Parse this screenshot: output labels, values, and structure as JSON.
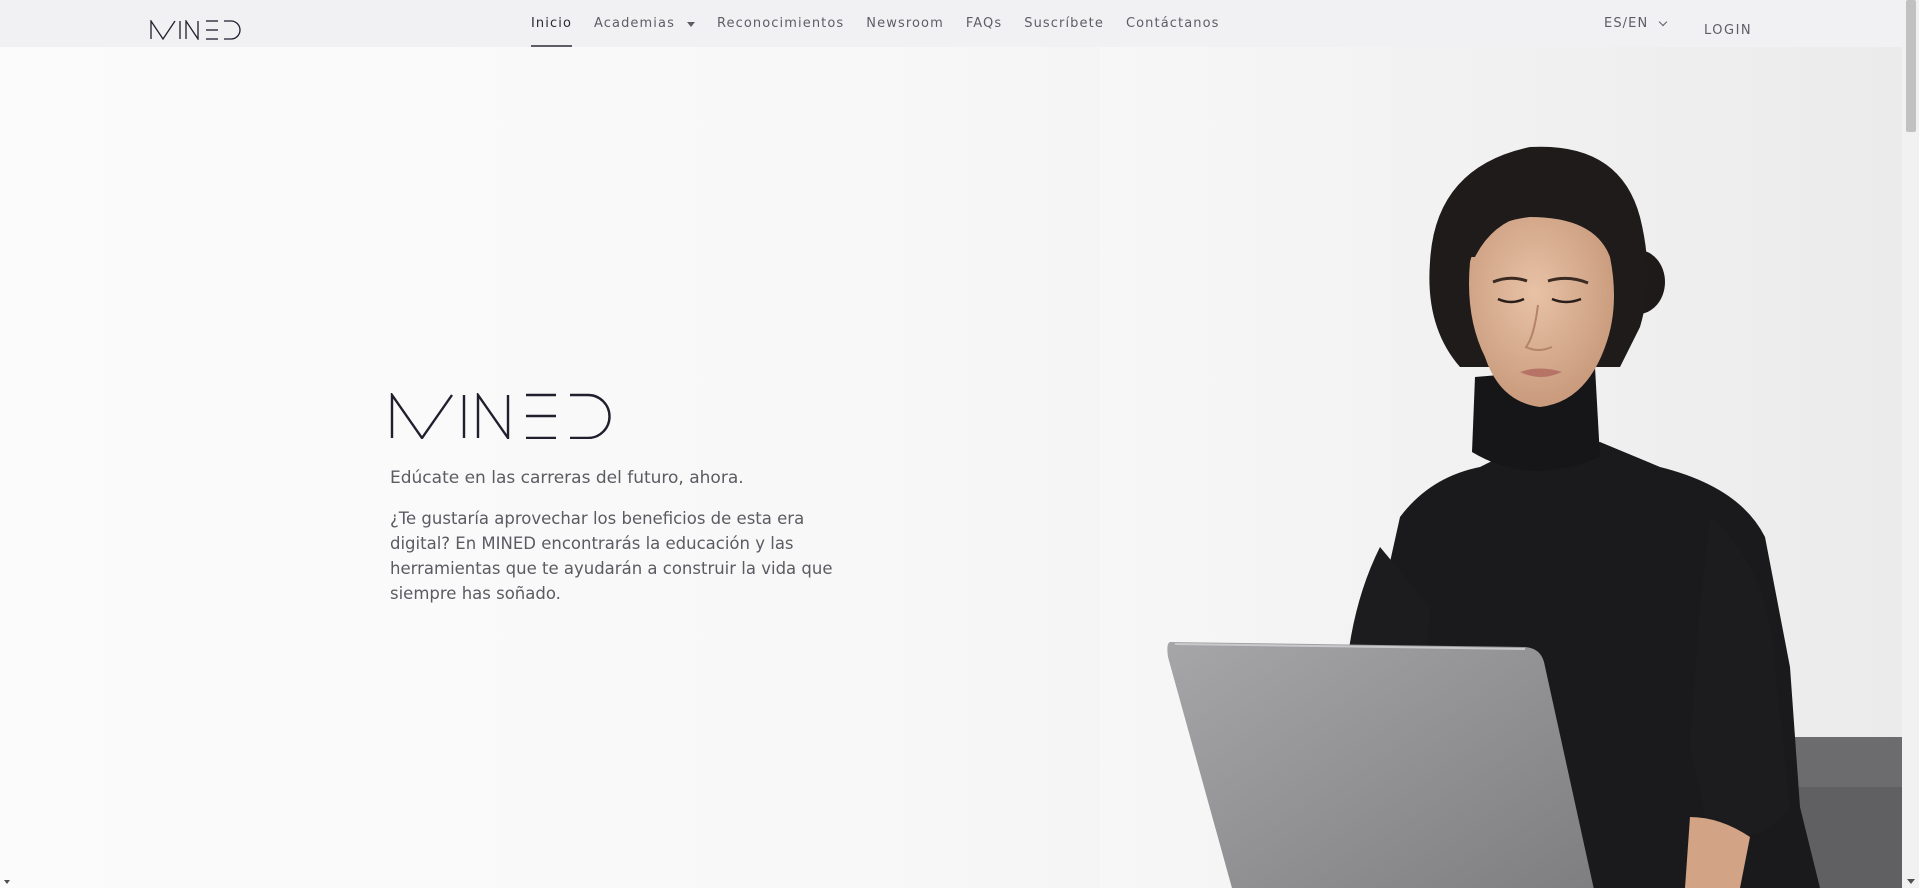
{
  "brand": {
    "name": "MINED"
  },
  "nav": {
    "items": [
      {
        "label": "Inicio",
        "active": true
      },
      {
        "label": "Academias",
        "dropdown": true
      },
      {
        "label": "Reconocimientos"
      },
      {
        "label": "Newsroom"
      },
      {
        "label": "FAQs"
      },
      {
        "label": "Suscríbete"
      },
      {
        "label": "Contáctanos"
      }
    ],
    "language": "ES/EN",
    "login": "LOGIN"
  },
  "hero": {
    "tagline": "Edúcate en las carreras del futuro, ahora.",
    "description": "¿Te gustaría aprovechar los beneficios de esta era digital? En MINED encontrarás la educación y las herramientas que te ayudarán a construir la vida que siempre has soñado."
  },
  "icons": {
    "academias_caret": "caret-down-icon",
    "language_chevron": "chevron-down-icon"
  },
  "colors": {
    "navbar_bg": "#f1f1f4",
    "text": "#5b5b62",
    "logo": "#1f1f2e"
  }
}
